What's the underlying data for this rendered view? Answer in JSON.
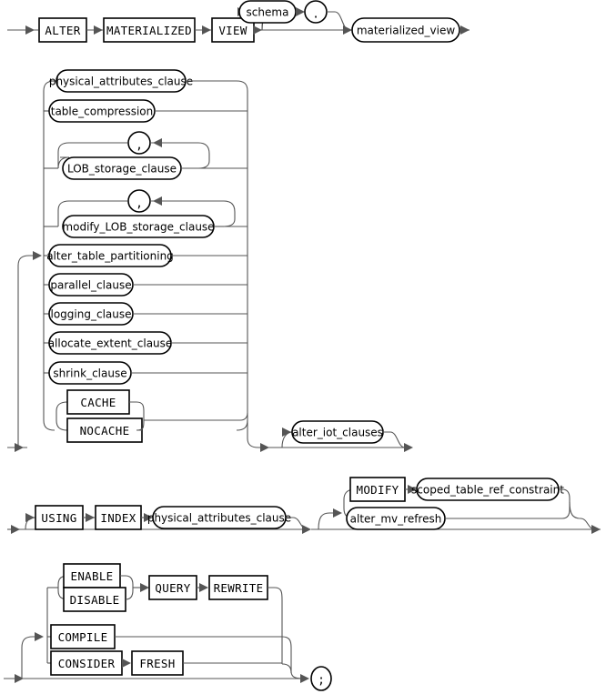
{
  "diagram": {
    "title": "alter_materialized_view",
    "type": "railroad-syntax-diagram",
    "stroke_color": "#555555",
    "node_stroke_color": "#000000",
    "background": "#ffffff"
  },
  "line1": {
    "keywords": {
      "alter": "ALTER",
      "materialized": "MATERIALIZED",
      "view": "VIEW"
    },
    "schema": "schema",
    "dot": ".",
    "materialized_view": "materialized_view"
  },
  "line2": {
    "options": [
      "physical_attributes_clause",
      "table_compression",
      "LOB_storage_clause",
      "modify_LOB_storage_clause",
      "alter_table_partitioning",
      "parallel_clause",
      "logging_clause",
      "allocate_extent_clause",
      "shrink_clause"
    ],
    "lob_comma": ",",
    "modify_lob_comma": ",",
    "cache": "CACHE",
    "nocache": "NOCACHE",
    "alter_iot_clauses": "alter_iot_clauses"
  },
  "line3": {
    "using": "USING",
    "index": "INDEX",
    "physical_attributes_clause": "physical_attributes_clause",
    "modify": "MODIFY",
    "scoped_table_ref_constraint": "scoped_table_ref_constraint",
    "alter_mv_refresh": "alter_mv_refresh"
  },
  "line4": {
    "enable": "ENABLE",
    "disable": "DISABLE",
    "query": "QUERY",
    "rewrite": "REWRITE",
    "compile": "COMPILE",
    "consider": "CONSIDER",
    "fresh": "FRESH",
    "semicolon": ";"
  }
}
